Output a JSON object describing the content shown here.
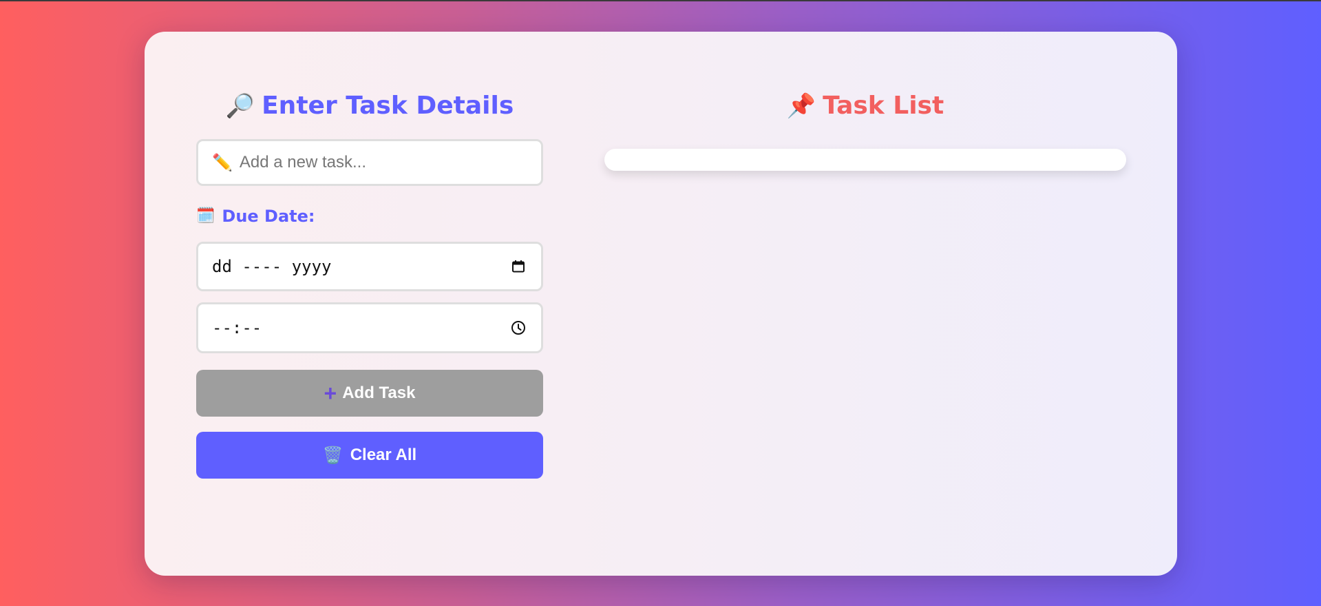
{
  "input_panel": {
    "title": "Enter Task Details",
    "title_icon": "magnifier-icon",
    "task_input": {
      "placeholder": "Add a new task...",
      "value": "",
      "icon": "pencil-icon"
    },
    "due_label": "Due Date:",
    "due_icon": "calendar-icon",
    "date_input": {
      "display": "dd ---- yyyy",
      "icon": "calendar-picker-icon"
    },
    "time_input": {
      "display": "--:--",
      "icon": "clock-icon"
    },
    "add_button": {
      "label": "Add Task",
      "icon": "plus-icon",
      "color": "#9e9e9e"
    },
    "clear_button": {
      "label": "Clear All",
      "icon": "trash-icon",
      "color": "#5f5fff"
    }
  },
  "list_panel": {
    "title": "Task List",
    "title_icon": "pushpin-icon",
    "tasks": []
  },
  "colors": {
    "accent": "#5f5fff",
    "list_title": "#f25f5f",
    "gradient_start": "#ff5f5f",
    "gradient_end": "#5f5fff"
  }
}
